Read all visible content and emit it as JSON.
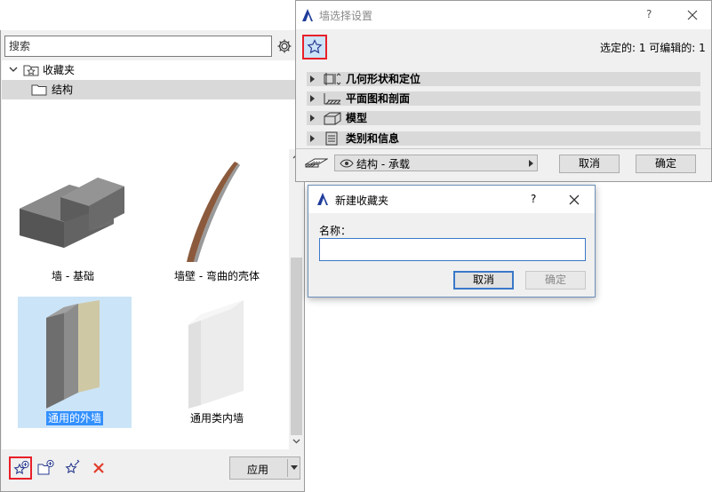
{
  "favorites": {
    "search_placeholder": "搜索",
    "tree": {
      "root_label": "收藏夹",
      "child_label": "结构"
    },
    "items": [
      {
        "label": "墙 - 基础"
      },
      {
        "label": "墙壁 - 弯曲的壳体"
      },
      {
        "label": "通用的外墙"
      },
      {
        "label": "通用类内墙"
      }
    ],
    "apply_label": "应用"
  },
  "settings_dialog": {
    "title": "墙选择设置",
    "help": "?",
    "selection_info": "选定的: 1 可编辑的: 1",
    "sections": [
      {
        "label": "几何形状和定位"
      },
      {
        "label": "平面图和剖面"
      },
      {
        "label": "模型"
      },
      {
        "label": "类别和信息"
      }
    ],
    "layer_value": "结构 - 承载",
    "cancel_label": "取消",
    "ok_label": "确定"
  },
  "new_folder_dialog": {
    "title": "新建收藏夹",
    "help": "?",
    "name_label": "名称：",
    "name_value": "",
    "cancel_label": "取消",
    "ok_label": "确定"
  },
  "colors": {
    "highlight_red": "#e8202a",
    "selection_bg": "#cce4f7",
    "selected_label_bg": "#3390ff",
    "delete_red": "#e23c2c"
  }
}
